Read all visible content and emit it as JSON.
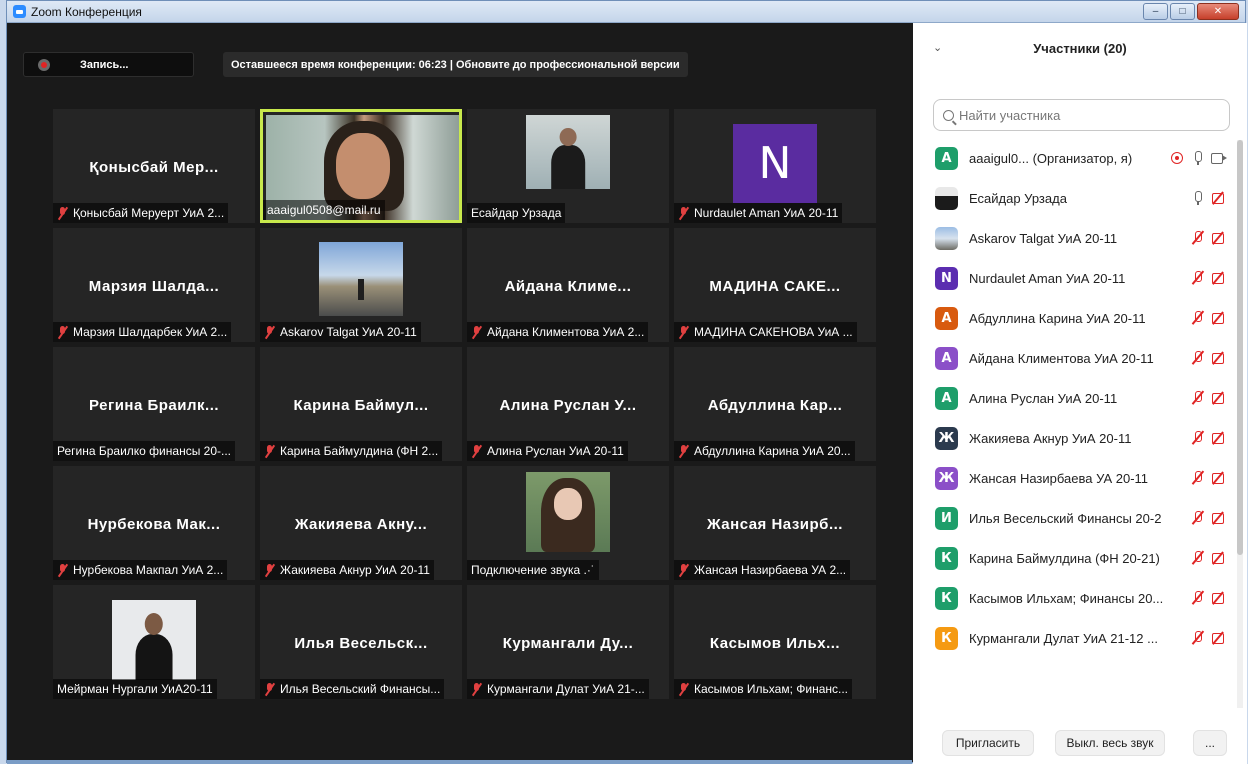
{
  "window": {
    "title": "Zoom Конференция",
    "buttons": [
      "–",
      "□",
      "✕"
    ]
  },
  "toolbar": {
    "record_label": "Запись...",
    "time_banner": "Оставшееся время конференции: 06:23 | Обновите до профессиональной версии"
  },
  "tiles": [
    {
      "name": "Қонысбай Мер...",
      "caption": "Қонысбай Меруерт УиА 2...",
      "muted": true
    },
    {
      "name": "",
      "caption": "aaaigul0508@mail.ru",
      "muted": false,
      "active": true
    },
    {
      "name": "",
      "caption": "Есайдар Урзада",
      "muted": false
    },
    {
      "name": "",
      "caption": "Nurdaulet Aman УиА 20-11",
      "muted": true,
      "avatar_letter": "N"
    },
    {
      "name": "Марзия Шалда...",
      "caption": "Марзия Шалдарбек УиА 2...",
      "muted": true
    },
    {
      "name": "",
      "caption": "Askarov Talgat УиА 20-11",
      "muted": true
    },
    {
      "name": "Айдана Климе...",
      "caption": "Айдана Климентова УиА 2...",
      "muted": true
    },
    {
      "name": "МАДИНА САКЕ...",
      "caption": "МАДИНА САКЕНОВА УиА ...",
      "muted": true
    },
    {
      "name": "Регина Браилк...",
      "caption": "Регина Браилко финансы 20-...",
      "muted": false
    },
    {
      "name": "Карина Баймул...",
      "caption": "Карина Баймулдина (ФН 2...",
      "muted": true
    },
    {
      "name": "Алина Руслан У...",
      "caption": "Алина Руслан УиА 20-11",
      "muted": true
    },
    {
      "name": "Абдуллина Кар...",
      "caption": "Абдуллина Карина УиА 20...",
      "muted": true
    },
    {
      "name": "Нурбекова Мак...",
      "caption": "Нурбекова Макпал УиА 2...",
      "muted": true
    },
    {
      "name": "Жакияева Акну...",
      "caption": "Жакияева Акнур УиА 20-11",
      "muted": true
    },
    {
      "name": "",
      "caption": "Подключение звука .·˙",
      "muted": false
    },
    {
      "name": "Жансая Назирб...",
      "caption": "Жансая Назирбаева УА 2...",
      "muted": true
    },
    {
      "name": "",
      "caption": "Мейрман Нургали УиА20-11",
      "muted": false
    },
    {
      "name": "Илья Весельск...",
      "caption": "Илья Весельский Финансы...",
      "muted": true
    },
    {
      "name": "Курмангали Ду...",
      "caption": "Курмангали Дулат УиА 21-...",
      "muted": true
    },
    {
      "name": "Касымов Ильх...",
      "caption": "Касымов Ильхам; Финанс...",
      "muted": true
    }
  ],
  "panel": {
    "title": "Участники (20)",
    "search_placeholder": "Найти участника",
    "participants": [
      {
        "letter": "A",
        "color": "#1e9e6a",
        "name": "aaaigul0...  (Организатор, я)",
        "status": "host"
      },
      {
        "letter": "",
        "color": "",
        "name": "Есайдар Урзада",
        "status": "mic-on"
      },
      {
        "letter": "",
        "color": "",
        "name": "Askarov Talgat УиА 20-11",
        "status": "off"
      },
      {
        "letter": "N",
        "color": "#5b2db0",
        "name": "Nurdaulet Aman УиА 20-11",
        "status": "off"
      },
      {
        "letter": "A",
        "color": "#d85a0f",
        "name": "Абдуллина Карина УиА 20-11",
        "status": "off"
      },
      {
        "letter": "A",
        "color": "#8b4fc8",
        "name": "Айдана Климентова УиА 20-11",
        "status": "off"
      },
      {
        "letter": "A",
        "color": "#1e9e6a",
        "name": "Алина Руслан УиА 20-11",
        "status": "off"
      },
      {
        "letter": "Ж",
        "color": "#2b3a4e",
        "name": "Жакияева Акнур УиА 20-11",
        "status": "off"
      },
      {
        "letter": "Ж",
        "color": "#8b4fc8",
        "name": "Жансая Назирбаева УА 20-11",
        "status": "off"
      },
      {
        "letter": "И",
        "color": "#1e9e6a",
        "name": "Илья Весельский Финансы 20-2",
        "status": "off"
      },
      {
        "letter": "К",
        "color": "#1e9e6a",
        "name": "Карина Баймулдина (ФН 20-21)",
        "status": "off"
      },
      {
        "letter": "К",
        "color": "#1e9e6a",
        "name": "Касымов Ильхам; Финансы 20...",
        "status": "off"
      },
      {
        "letter": "К",
        "color": "#f59a12",
        "name": "Курмангали Дулат УиА 21-12 ...",
        "status": "off"
      }
    ],
    "invite_label": "Пригласить",
    "mute_all_label": "Выкл. весь звук",
    "more_label": "..."
  }
}
